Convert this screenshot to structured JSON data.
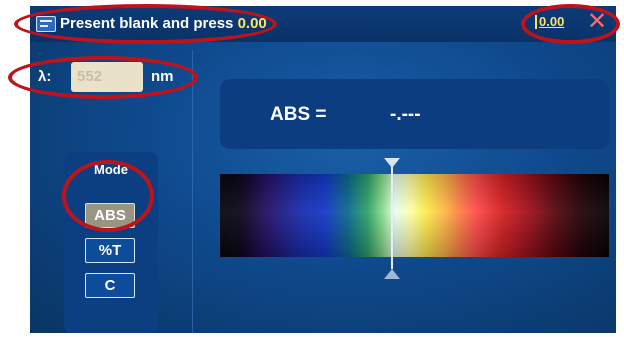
{
  "titlebar": {
    "prompt": "Present blank and press",
    "prompt_value": "0.00",
    "zero_label": "0.00",
    "close_symbol": "✕"
  },
  "wavelength": {
    "label": "λ:",
    "value": "552",
    "unit": "nm"
  },
  "reading": {
    "label": "ABS =",
    "value": "-.---"
  },
  "mode": {
    "title": "Mode",
    "options": [
      "ABS",
      "%T",
      "C"
    ],
    "selected": "ABS"
  },
  "colors": {
    "accent": "#ffe16b",
    "close": "#ff6b6b",
    "annotation": "#c0121b",
    "panel": "#0b3d80"
  }
}
